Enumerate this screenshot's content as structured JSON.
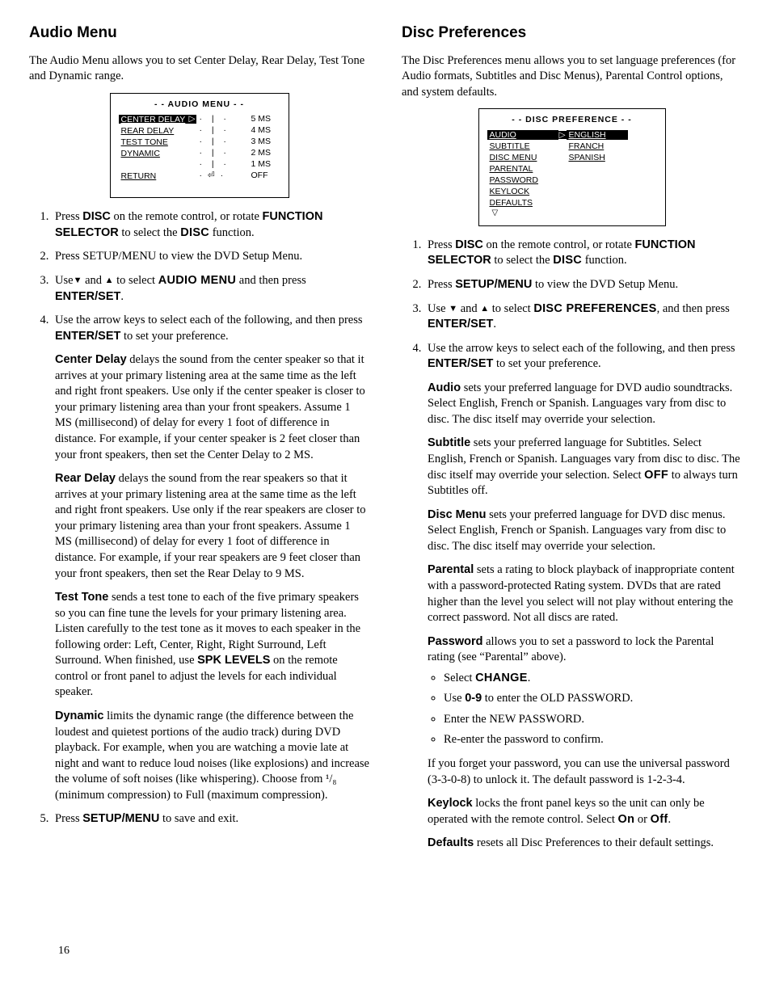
{
  "page_number": "16",
  "left": {
    "heading": "Audio Menu",
    "intro": "The Audio Menu allows you to set Center Delay, Rear Delay, Test Tone and Dynamic range.",
    "osd": {
      "title": "- - AUDIO MENU - -",
      "rows": [
        {
          "label": "CENTER DELAY",
          "selected": true,
          "val": "5 MS"
        },
        {
          "label": "REAR DELAY",
          "val": "4 MS"
        },
        {
          "label": "TEST TONE",
          "val": "3 MS"
        },
        {
          "label": "DYNAMIC",
          "val": "2 MS"
        },
        {
          "label": "",
          "val": "1 MS"
        },
        {
          "label": "RETURN",
          "val": "OFF"
        }
      ]
    },
    "step1_a": "Press ",
    "step1_disc": "DISC",
    "step1_b": " on the remote control, or rotate ",
    "step1_fs": "FUNCTION SELECTOR",
    "step1_c": " to select the ",
    "step1_discfn": "DISC",
    "step1_d": " function.",
    "step2": "Press SETUP/MENU to view the DVD Setup Menu.",
    "step3_a": "Use",
    "step3_b": " and ",
    "step3_c": " to select ",
    "step3_m": "AUDIO MENU",
    "step3_d": " and then press ",
    "step3_es": "ENTER/SET",
    "step3_e": ".",
    "step4_a": "Use the arrow keys to select each of the following, and then press ",
    "step4_es": "ENTER/SET",
    "step4_b": " to set your preference.",
    "cd_h": "Center Delay",
    "cd_t": " delays the sound from the center speaker so that it arrives at your primary listening area at the same time as the left and right front speakers. Use only if the center speaker is closer to your primary listening area than your front speakers. Assume 1 MS (millisecond) of delay for every 1 foot of difference in distance. For example, if your center speaker is 2 feet closer than your front speakers, then set the Center Delay to 2 MS.",
    "rd_h": "Rear Delay",
    "rd_t": " delays the sound from the rear speakers so that it arrives at your primary listening area at the same time as the left and right front speakers. Use only if the rear speakers are closer to your primary listening area than your front speakers. Assume 1 MS (millisecond) of delay for every 1 foot of difference in distance. For example, if your rear speakers are 9 feet closer than your front speakers, then set the Rear Delay to 9 MS.",
    "tt_h": "Test Tone",
    "tt_t1": " sends a test tone to each of the five primary speakers so you can fine tune the levels for your primary listening area. Listen carefully to the test tone as it moves to each speaker in the following order: Left, Center, Right, Right Surround, Left Surround. When finished, use ",
    "tt_spk": "SPK LEVELS",
    "tt_t2": " on the remote control or front panel to adjust the levels for each individual speaker.",
    "dy_h": "Dynamic",
    "dy_t": " limits the dynamic range (the difference between the loudest and quietest portions of the audio track) during DVD playback. For example, when you are watching a movie late at night and want to reduce loud noises (like explosions) and increase the volume of soft noises (like whispering). Choose from ¹/₈ (minimum compression) to Full (maximum compression).",
    "step5_a": "Press ",
    "step5_sm": "SETUP/MENU",
    "step5_b": " to save and exit."
  },
  "right": {
    "heading": "Disc Preferences",
    "intro": "The Disc Preferences menu allows you to set language preferences (for Audio formats, Subtitles and Disc Menus), Parental Control options, and system defaults.",
    "osd": {
      "title": "- - DISC PREFERENCE - -",
      "left": [
        "AUDIO",
        "SUBTITLE",
        "DISC MENU",
        "PARENTAL",
        "PASSWORD",
        "KEYLOCK",
        "DEFAULTS"
      ],
      "right": [
        "ENGLISH",
        "FRANCH",
        "SPANISH"
      ]
    },
    "step1_a": "Press ",
    "step1_disc": "DISC",
    "step1_b": " on the remote control, or rotate ",
    "step1_fs": "FUNCTION SELECTOR",
    "step1_c": " to select the ",
    "step1_discfn": "DISC",
    "step1_d": " function.",
    "step2_a": "Press ",
    "step2_sm": "SETUP/MENU",
    "step2_b": " to view the DVD Setup Menu.",
    "step3_a": "Use ",
    "step3_b": " and ",
    "step3_c": " to select ",
    "step3_m": "DISC PREFERENCES",
    "step3_d": ", and then press ",
    "step3_es": "ENTER/SET",
    "step3_e": ".",
    "step4_a": "Use the arrow keys to select each of the following, and then press ",
    "step4_es": "ENTER/SET",
    "step4_b": " to set your preference.",
    "au_h": "Audio",
    "au_t": " sets your preferred language for DVD audio soundtracks. Select English, French or Spanish. Languages vary from disc to disc. The disc itself may override your selection.",
    "su_h": "Subtitle",
    "su_t1": " sets your preferred language for Subtitles. Select English, French or Spanish. Languages vary from disc to disc. The disc itself may override your selection. Select ",
    "su_off": "OFF",
    "su_t2": " to always turn Subtitles off.",
    "dm_h": "Disc Menu",
    "dm_t": " sets your preferred language for DVD disc menus. Select English, French or Spanish. Languages vary from disc to disc. The disc itself may override your selection.",
    "pa_h": "Parental",
    "pa_t": " sets a rating to block playback of inappropriate content with a password-protected Rating system. DVDs that are rated higher than the level you select will not play without entering the correct password. Not all discs are rated.",
    "pw_h": "Password",
    "pw_t": " allows you to set a password to lock the Parental rating (see “Parental” above).",
    "pw_b1a": "Select ",
    "pw_b1b": "CHANGE",
    "pw_b1c": ".",
    "pw_b2a": "Use ",
    "pw_b2b": "0-9",
    "pw_b2c": " to enter the OLD PASSWORD.",
    "pw_b3": "Enter the NEW PASSWORD.",
    "pw_b4": "Re-enter the password to confirm.",
    "pw_note": "If you forget your password, you can use the universal password (3-3-0-8) to unlock it. The default password is 1-2-3-4.",
    "kl_h": "Keylock",
    "kl_t1": " locks the front panel keys so the unit can only be operated with the remote control. Select ",
    "kl_on": "On",
    "kl_t2": " or ",
    "kl_off": "Off",
    "kl_t3": ".",
    "df_h": "Defaults",
    "df_t": " resets all Disc Preferences to their default settings."
  }
}
